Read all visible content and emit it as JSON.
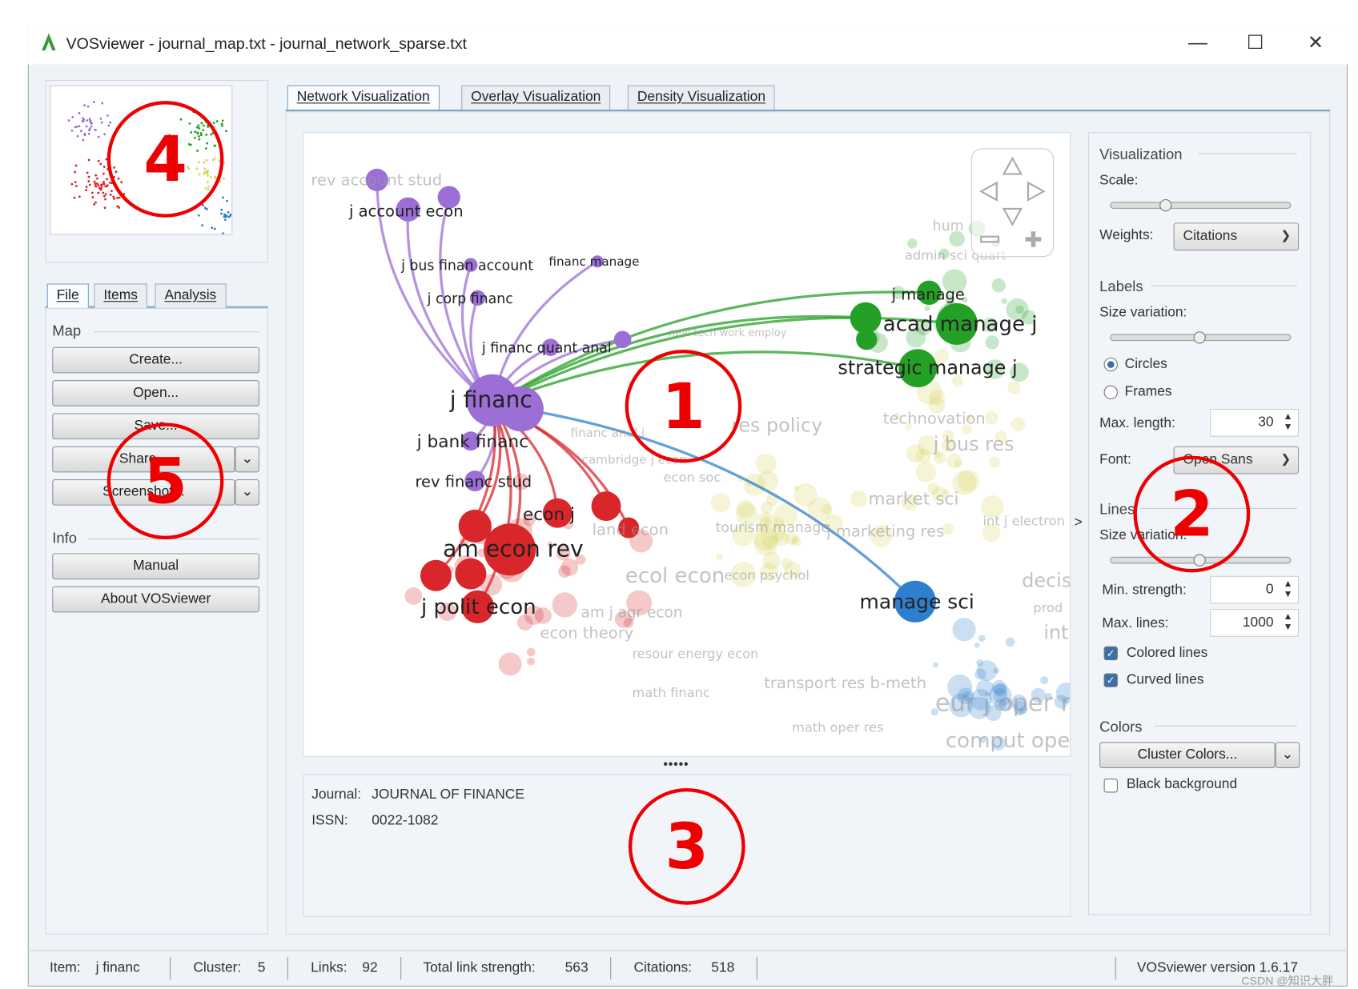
{
  "window": {
    "title": "VOSviewer - journal_map.txt - journal_network_sparse.txt",
    "minimize": "—",
    "maximize": "☐",
    "close": "✕"
  },
  "left_tabs": [
    {
      "label": "File"
    },
    {
      "label": "Items"
    },
    {
      "label": "Analysis"
    }
  ],
  "left": {
    "map_section": "Map",
    "buttons": [
      "Create...",
      "Open...",
      "Save...",
      "Share...",
      "Screenshot..."
    ],
    "info_section": "Info",
    "info_buttons": [
      "Manual",
      "About VOSviewer"
    ]
  },
  "viz_tabs": [
    {
      "label": "Network Visualization",
      "active": true
    },
    {
      "label": "Overlay Visualization"
    },
    {
      "label": "Density Visualization"
    }
  ],
  "network": {
    "cluster_colors": {
      "purple": "#9b6fd6",
      "red": "#d9262b",
      "green": "#25a026",
      "blue": "#2f7fcf",
      "yellow": "#d9d25a"
    },
    "labels": [
      "j account econ",
      "j bus finan account",
      "financ manage",
      "j corp financ",
      "j financ quant anal",
      "j financ",
      "j bank financ",
      "rev financ stud",
      "econ j",
      "am econ rev",
      "j polit econ",
      "j manage",
      "acad manage j",
      "strategic manage j",
      "manage sci"
    ],
    "faded_labels": [
      "rev account stud",
      "hum",
      "admin sci quart",
      "new tech work employ",
      "res policy",
      "technovation",
      "j bus res",
      "econ soc",
      "market sci",
      "tourism manage",
      "j marketing res",
      "int j electron",
      "ecol econ",
      "econ psychol",
      "decis",
      "am j agr econ",
      "prod",
      "int",
      "resour energy econ",
      "transport res b-meth",
      "math financ",
      "eur j oper r",
      "math oper res",
      "comput oper",
      "econ theory",
      "financ anal j",
      "cambridge j econ",
      "land econ"
    ]
  },
  "details": {
    "journal_label": "Journal:",
    "journal": "JOURNAL OF FINANCE",
    "issn_label": "ISSN:",
    "issn": "0022-1082"
  },
  "right": {
    "visualization": "Visualization",
    "scale": "Scale:",
    "scale_value": 0.3,
    "weights": "Weights:",
    "weights_value": "Citations",
    "labels": "Labels",
    "size_variation": "Size variation:",
    "label_size_value": 0.5,
    "circles": "Circles",
    "frames": "Frames",
    "max_length": "Max. length:",
    "max_length_value": "30",
    "font": "Font:",
    "font_value": "Open Sans",
    "lines": "Lines",
    "line_size_variation": "Size variation:",
    "line_size_value": 0.5,
    "min_strength": "Min. strength:",
    "min_strength_value": "0",
    "max_lines": "Max. lines:",
    "max_lines_value": "1000",
    "colored_lines": "Colored lines",
    "curved_lines": "Curved lines",
    "colors": "Colors",
    "cluster_colors": "Cluster Colors...",
    "black_background": "Black background",
    "collapse": ">"
  },
  "status": {
    "item_label": "Item:",
    "item": "j financ",
    "cluster_label": "Cluster:",
    "cluster": "5",
    "links_label": "Links:",
    "links": "92",
    "tls_label": "Total link strength:",
    "tls": "563",
    "citations_label": "Citations:",
    "citations": "518",
    "version": "VOSviewer version 1.6.17"
  },
  "annotations": [
    "1",
    "2",
    "3",
    "4",
    "5"
  ],
  "watermark": "CSDN @知识大胖"
}
